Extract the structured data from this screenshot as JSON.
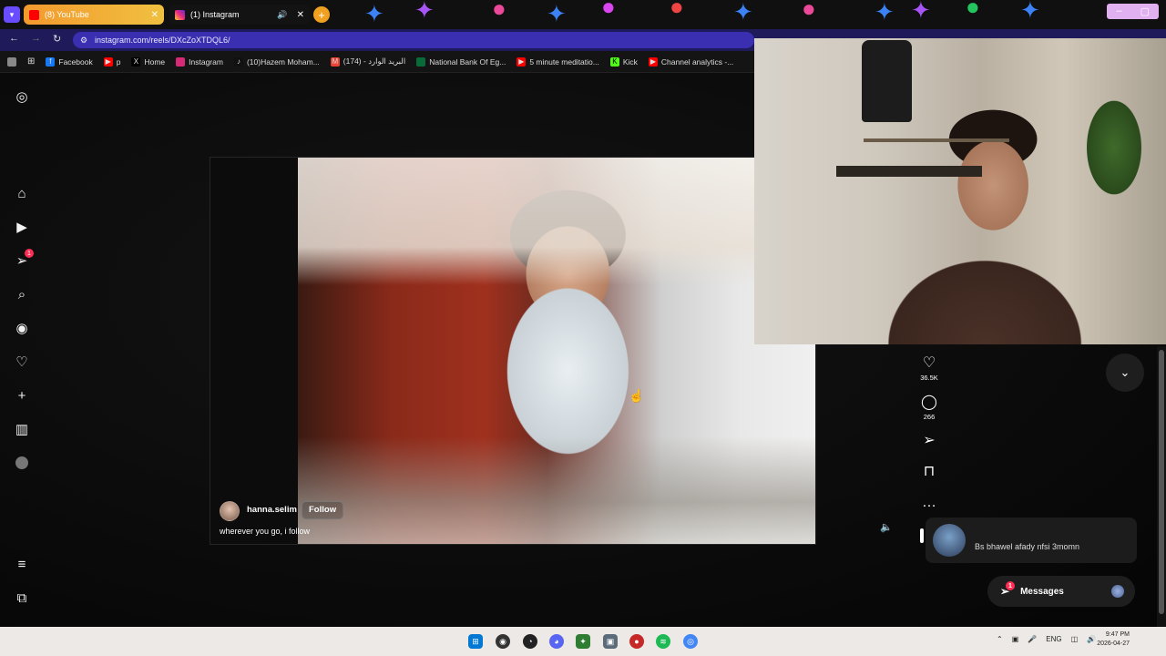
{
  "browser": {
    "tabs": [
      {
        "label": "(8) YouTube",
        "active": false
      },
      {
        "label": "(1) Instagram",
        "active": true
      }
    ],
    "url": "instagram.com/reels/DXcZoXTDQL6/",
    "bookmarks": [
      {
        "label": "Facebook",
        "icon": "facebook-icon",
        "color": "#1877f2"
      },
      {
        "label": "p",
        "icon": "youtube-icon",
        "color": "#ff0000"
      },
      {
        "label": "Home",
        "icon": "x-icon",
        "color": "#000000"
      },
      {
        "label": "Instagram",
        "icon": "instagram-icon",
        "color": "#d62976"
      },
      {
        "label": "(10)Hazem Moham...",
        "icon": "tiktok-icon",
        "color": "#111111"
      },
      {
        "label": "(174) - البريد الوارد",
        "icon": "gmail-icon",
        "color": "#ea4335"
      },
      {
        "label": "National Bank Of Eg...",
        "icon": "bank-icon",
        "color": "#0a6b3a"
      },
      {
        "label": "5 minute meditatio...",
        "icon": "youtube-icon",
        "color": "#ff0000"
      },
      {
        "label": "Kick",
        "icon": "kick-icon",
        "color": "#53fc18"
      },
      {
        "label": "Channel analytics -...",
        "icon": "youtube-icon",
        "color": "#ff0000"
      }
    ]
  },
  "reel": {
    "author": "hanna.selim",
    "follow_label": "Follow",
    "caption": "wherever you go, i follow",
    "likes": "36.5K",
    "comments": "266"
  },
  "notification": {
    "title": "",
    "text": "Bs bhawel afady nfsi 3momn"
  },
  "messages": {
    "label": "Messages",
    "badge": "1"
  },
  "sidebar": {
    "notifications_badge": "1"
  },
  "taskbar": {
    "language": "ENG",
    "time": "9:47 PM",
    "date": "2026-04-27"
  },
  "colors": {
    "accent_badge": "#ff2d55",
    "page_bg": "#0b0b0b",
    "url_bar": "#3a2fb0"
  }
}
